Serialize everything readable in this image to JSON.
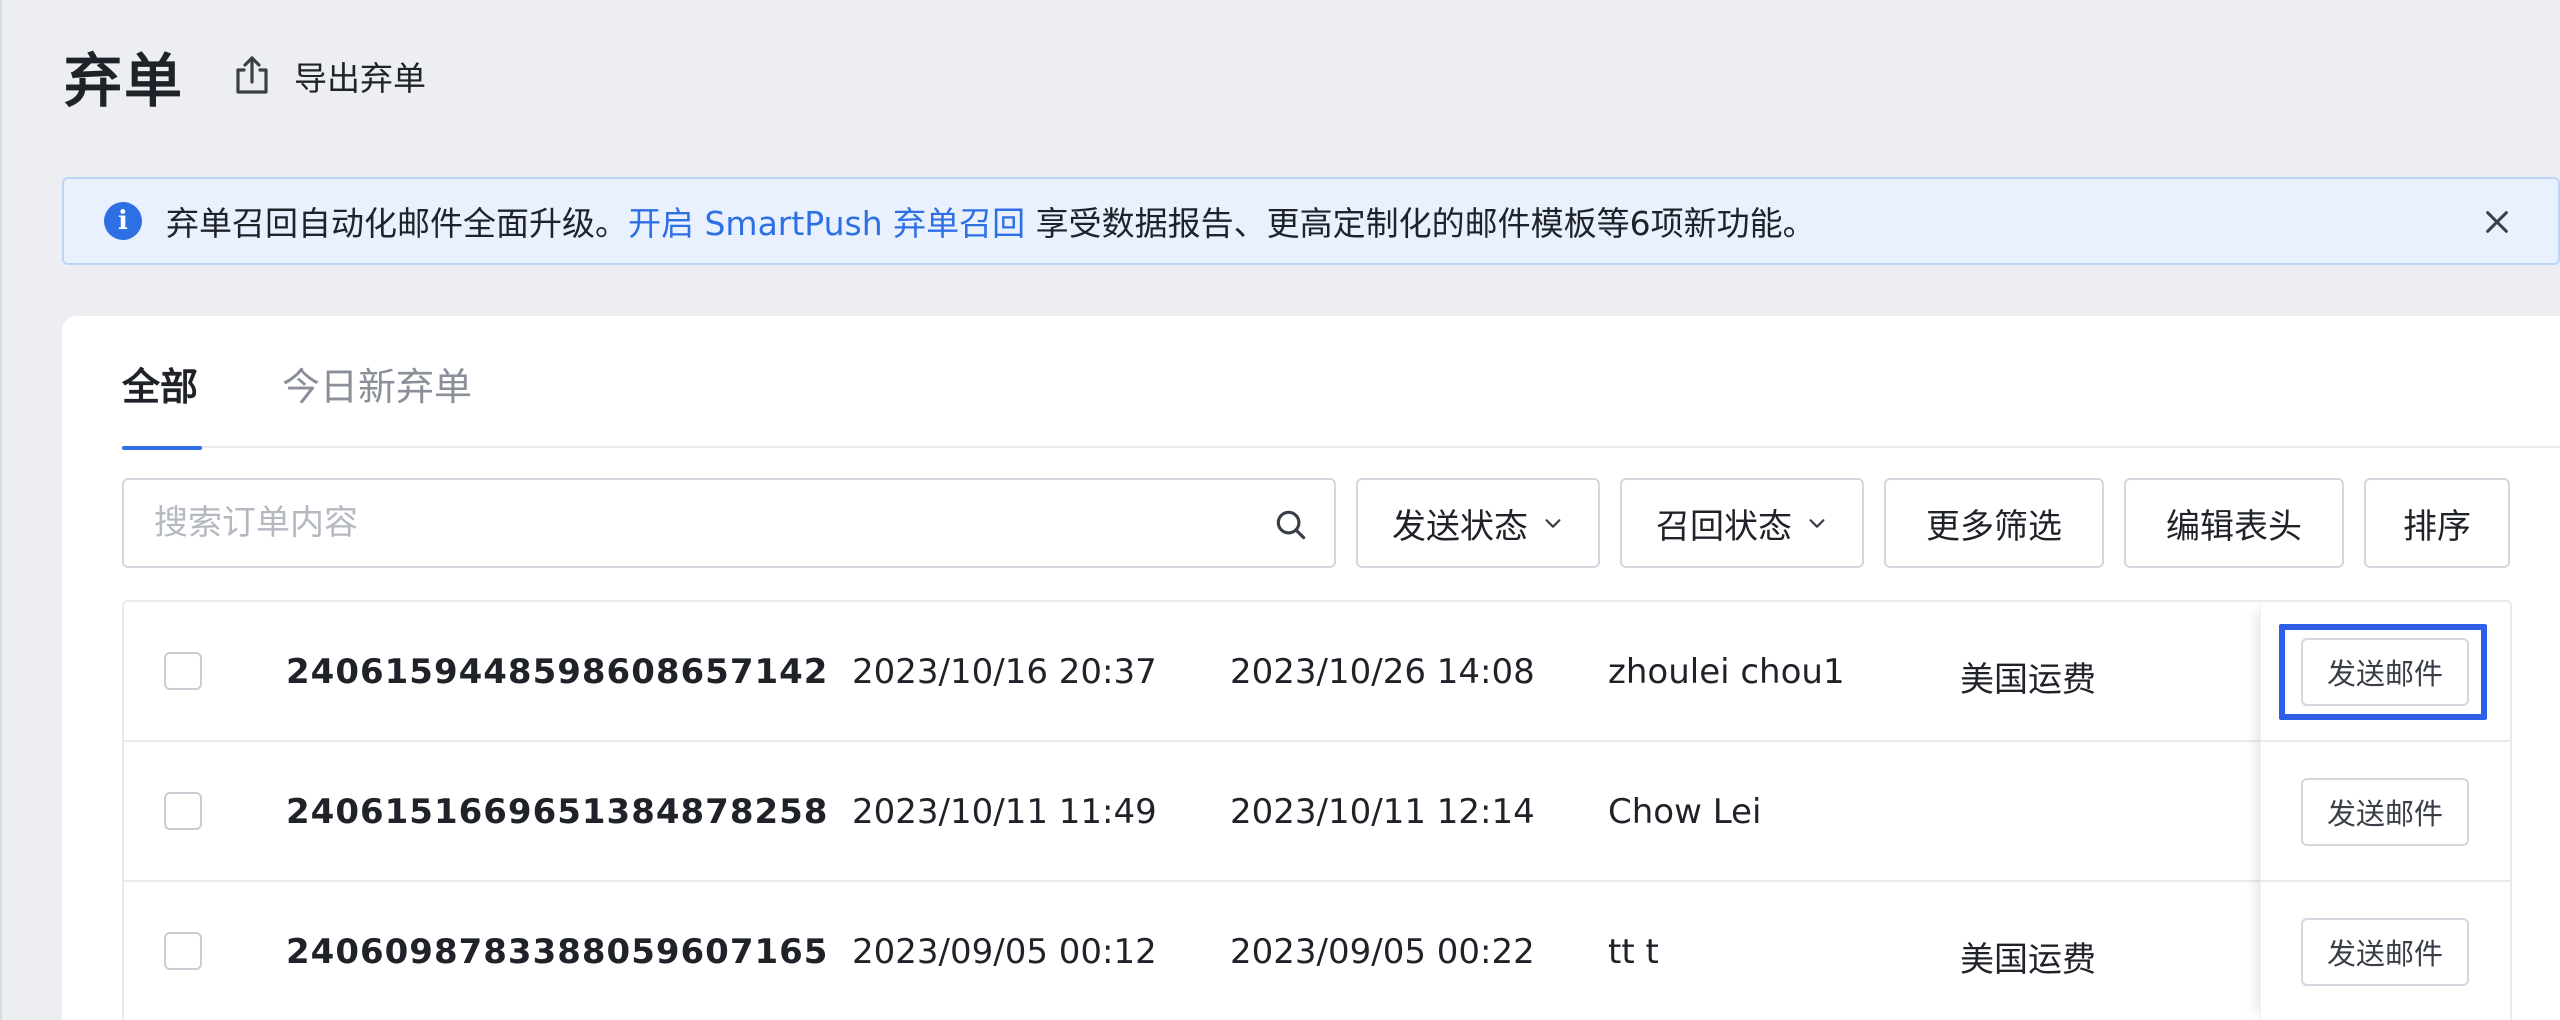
{
  "header": {
    "title": "弃单",
    "export_label": "导出弃单"
  },
  "notice": {
    "text_before": "弃单召回自动化邮件全面升级。",
    "link": "开启 SmartPush 弃单召回",
    "text_after": " 享受数据报告、更高定制化的邮件模板等6项新功能。"
  },
  "tabs": [
    {
      "label": "全部",
      "active": true
    },
    {
      "label": "今日新弃单",
      "active": false
    }
  ],
  "filters": {
    "search_placeholder": "搜索订单内容",
    "send_status": "发送状态",
    "recall_status": "召回状态",
    "more_filters": "更多筛选",
    "edit_header": "编辑表头",
    "sort": "排序"
  },
  "rows": [
    {
      "id": "2406159448598608657142",
      "created": "2023/10/16 20:37",
      "updated": "2023/10/26 14:08",
      "customer": "zhoulei chou1",
      "shipping": "美国运费",
      "action": "发送邮件"
    },
    {
      "id": "2406151669651384878258",
      "created": "2023/10/11 11:49",
      "updated": "2023/10/11 12:14",
      "customer": "Chow Lei",
      "shipping": "",
      "action": "发送邮件"
    },
    {
      "id": "2406098783388059607165",
      "created": "2023/09/05 00:12",
      "updated": "2023/09/05 00:22",
      "customer": "tt t",
      "shipping": "美国运费",
      "action": "发送邮件"
    }
  ],
  "colors": {
    "accent": "#2f6fe4",
    "highlight": "#2f5fe8",
    "banner_bg": "#e8f1fd"
  },
  "icons": {
    "export": "export-icon",
    "info": "info-icon",
    "close": "close-icon",
    "search": "search-icon",
    "dropdown": "chevron-down-icon"
  }
}
